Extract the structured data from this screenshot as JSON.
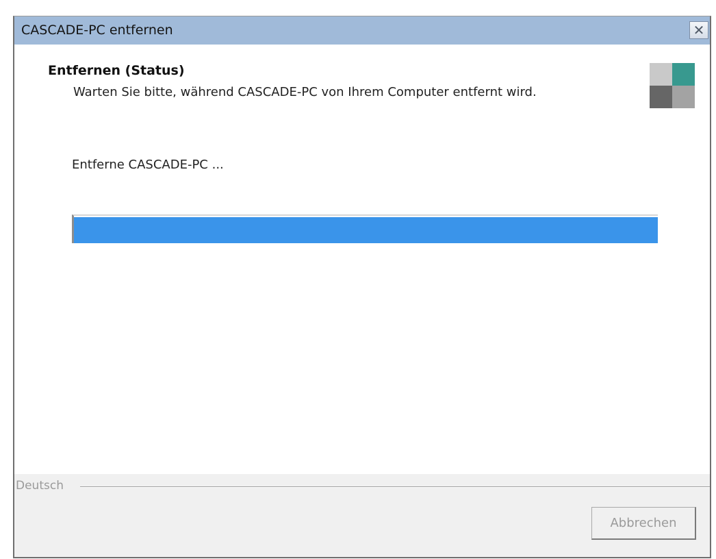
{
  "window": {
    "title": "CASCADE-PC entfernen",
    "close_symbol": "✕"
  },
  "header": {
    "heading": "Entfernen (Status)",
    "description": "Warten Sie bitte, während CASCADE-PC von Ihrem Computer entfernt wird.",
    "logo_icon": "installer-logo-icon"
  },
  "main": {
    "status_text": "Entferne CASCADE-PC ...",
    "progress_percent": 100
  },
  "footer": {
    "language_label": "Deutsch",
    "cancel_label": "Abbrechen"
  },
  "colors": {
    "title_bar": "#a0bad9",
    "progress_fill": "#3a94ea",
    "logo_teal": "#38998f"
  }
}
